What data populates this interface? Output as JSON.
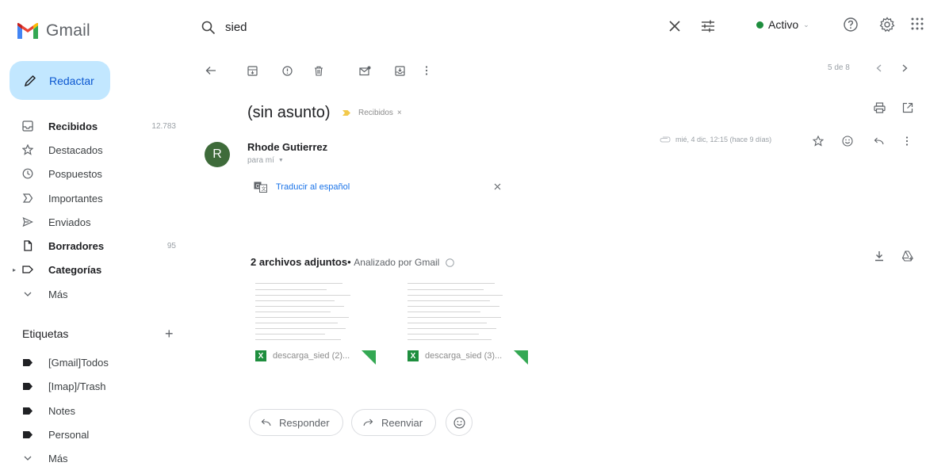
{
  "app": {
    "name": "Gmail"
  },
  "search": {
    "query": "sied"
  },
  "status": {
    "label": "Activo",
    "color": "#1e8e3e"
  },
  "compose": {
    "label": "Redactar"
  },
  "nav": [
    {
      "label": "Recibidos",
      "count": "12.783",
      "bold": true,
      "icon": "inbox-icon"
    },
    {
      "label": "Destacados",
      "count": "",
      "bold": false,
      "icon": "star-icon"
    },
    {
      "label": "Pospuestos",
      "count": "",
      "bold": false,
      "icon": "clock-icon"
    },
    {
      "label": "Importantes",
      "count": "",
      "bold": false,
      "icon": "important-icon"
    },
    {
      "label": "Enviados",
      "count": "",
      "bold": false,
      "icon": "send-icon"
    },
    {
      "label": "Borradores",
      "count": "95",
      "bold": true,
      "icon": "draft-icon"
    },
    {
      "label": "Categorías",
      "count": "",
      "bold": true,
      "icon": "label-outline-icon"
    },
    {
      "label": "Más",
      "count": "",
      "bold": false,
      "icon": "chevron-down-icon"
    }
  ],
  "labels": {
    "heading": "Etiquetas",
    "items": [
      {
        "label": "[Gmail]Todos"
      },
      {
        "label": "[Imap]/Trash"
      },
      {
        "label": "Notes"
      },
      {
        "label": "Personal"
      },
      {
        "label": "Más"
      }
    ]
  },
  "pager": {
    "text": "5 de 8"
  },
  "message": {
    "subject": "(sin asunto)",
    "label_chip": "Recibidos",
    "sender": "Rhode Gutierrez",
    "avatar_letter": "R",
    "recipient": "para mí",
    "date": "mié, 4 dic, 12:15 (hace 9 días)",
    "translate": "Traducir al español"
  },
  "attachments": {
    "count_label": "2 archivos adjuntos",
    "scanned": "Analizado por Gmail",
    "files": [
      {
        "name": "descarga_sied (2)..."
      },
      {
        "name": "descarga_sied (3)..."
      }
    ]
  },
  "actions": {
    "reply": "Responder",
    "forward": "Reenviar"
  },
  "colors": {
    "accent": "#0b57d0",
    "compose_bg": "#c2e7ff",
    "avatar_bg": "#3e6b3a",
    "important": "#f2c94c",
    "excel": "#1e8e3e"
  }
}
